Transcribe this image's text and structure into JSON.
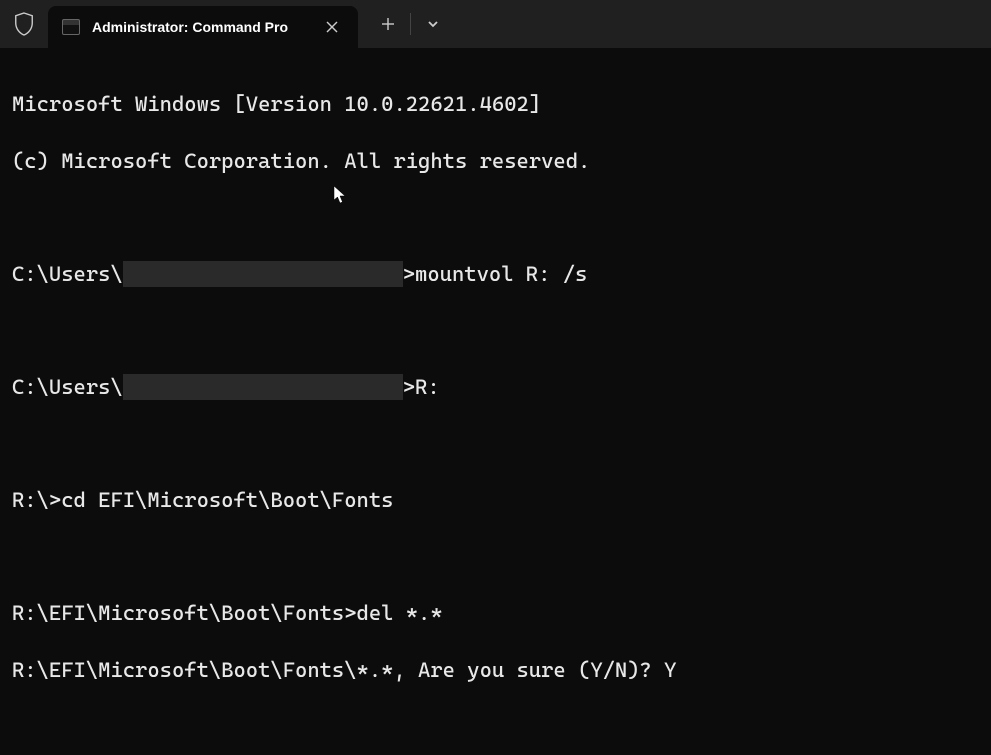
{
  "tab": {
    "title": "Administrator: Command Pro"
  },
  "terminal": {
    "line1": "Microsoft Windows [Version 10.0.22621.4602]",
    "line2": "(c) Microsoft Corporation. All rights reserved.",
    "prompt1_pre": "C:\\Users\\",
    "prompt1_post": ">mountvol R: /s",
    "prompt2_pre": "C:\\Users\\",
    "prompt2_post": ">R:",
    "line5": "R:\\>cd EFI\\Microsoft\\Boot\\Fonts",
    "line6": "R:\\EFI\\Microsoft\\Boot\\Fonts>del *.*",
    "line7": "R:\\EFI\\Microsoft\\Boot\\Fonts\\*.*, Are you sure (Y/N)? Y"
  }
}
